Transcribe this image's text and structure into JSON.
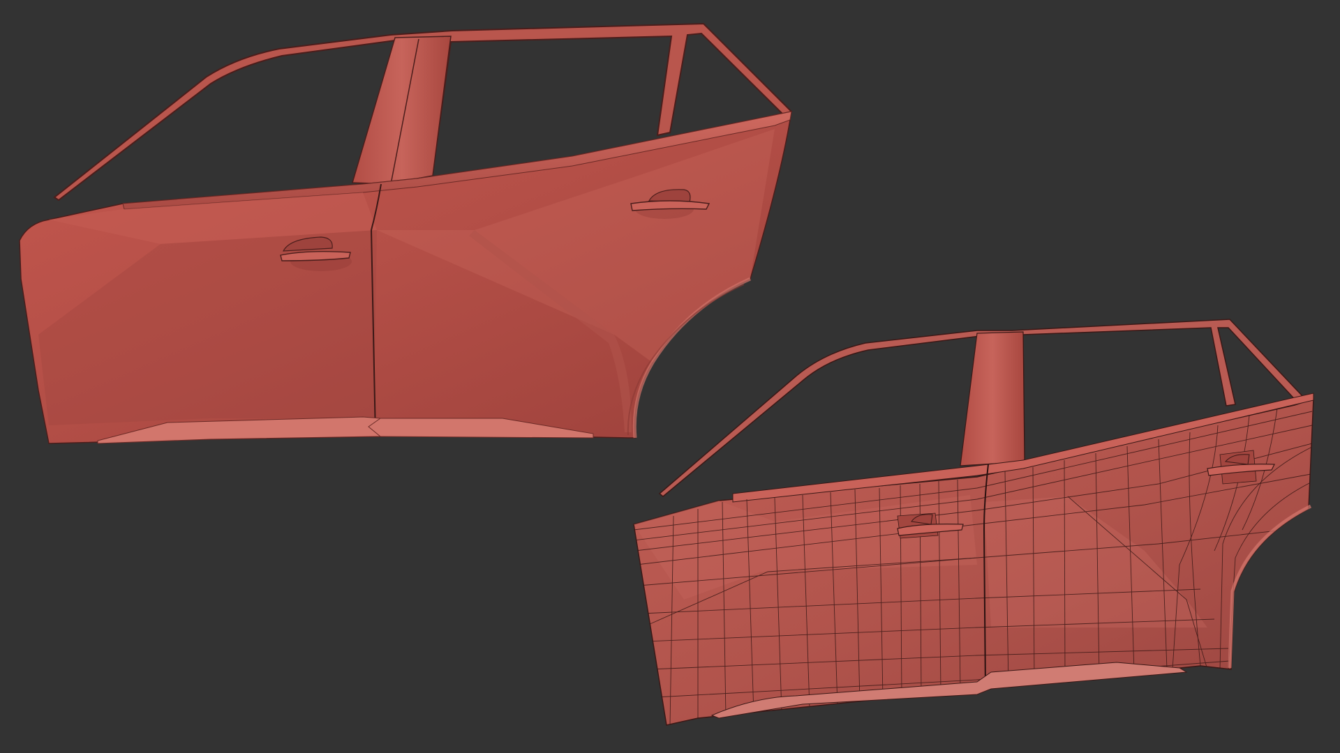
{
  "scene": {
    "background_color": "#333333",
    "subject": "car-side-doors-3d-render",
    "views": [
      {
        "id": "shaded",
        "render_mode": "smooth-shaded",
        "wireframe": false
      },
      {
        "id": "wireframe",
        "render_mode": "shaded-with-wireframe",
        "wireframe": true
      }
    ]
  },
  "colors": {
    "body": "#b8524a",
    "body_light": "#c96259",
    "body_dark": "#8d3a35",
    "edge": "#4a1d1b",
    "wire": "#3a1816",
    "glass": "#333333"
  }
}
